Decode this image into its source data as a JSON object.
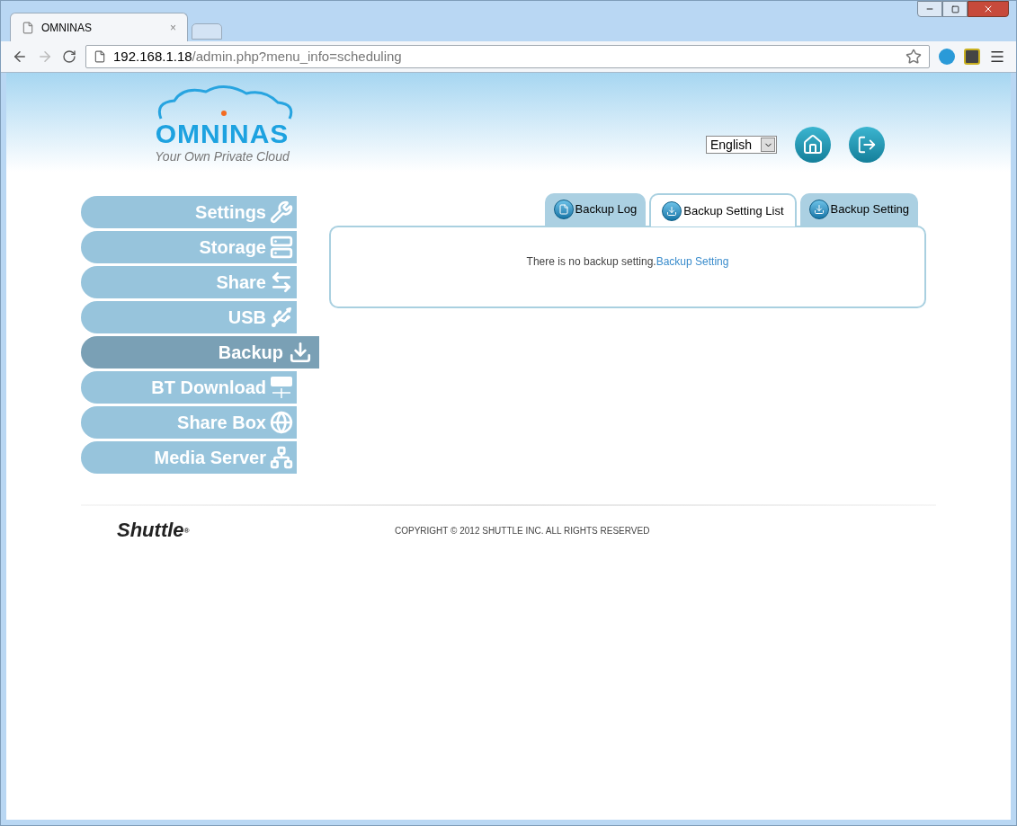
{
  "browser": {
    "tab_title": "OMNINAS",
    "close_glyph": "×",
    "url_host": "192.168.1.18",
    "url_path": "/admin.php?menu_info=scheduling"
  },
  "header": {
    "logo_name": "OMNINAS",
    "logo_tagline": "Your Own Private Cloud",
    "language": "English"
  },
  "sidebar": {
    "items": [
      {
        "label": "Settings",
        "selected": false
      },
      {
        "label": "Storage",
        "selected": false
      },
      {
        "label": "Share",
        "selected": false
      },
      {
        "label": "USB",
        "selected": false
      },
      {
        "label": "Backup",
        "selected": true
      },
      {
        "label": "BT Download",
        "selected": false
      },
      {
        "label": "Share Box",
        "selected": false
      },
      {
        "label": "Media Server",
        "selected": false
      }
    ]
  },
  "tabs": [
    {
      "label": "Backup Log",
      "selected": false
    },
    {
      "label": "Backup Setting List",
      "selected": true
    },
    {
      "label": "Backup Setting",
      "selected": false
    }
  ],
  "content": {
    "message": "There is no backup setting.",
    "link": "Backup Setting"
  },
  "footer": {
    "brand": "Shuttle",
    "registered": "®",
    "copyright": "COPYRIGHT © 2012 SHUTTLE INC. ALL RIGHTS RESERVED"
  }
}
